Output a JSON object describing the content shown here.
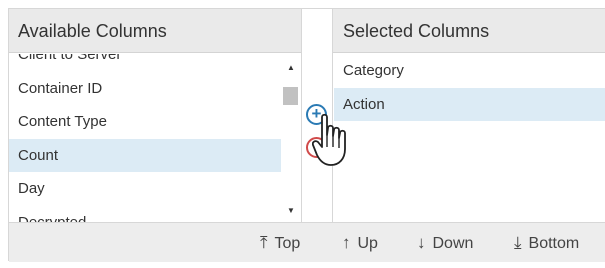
{
  "available": {
    "header": "Available Columns",
    "items": [
      {
        "label": "Client to Server"
      },
      {
        "label": "Container ID"
      },
      {
        "label": "Content Type"
      },
      {
        "label": "Count"
      },
      {
        "label": "Day"
      },
      {
        "label": "Decrypted"
      }
    ],
    "selected_item": "Count"
  },
  "selected": {
    "header": "Selected Columns",
    "items": [
      {
        "label": "Category"
      },
      {
        "label": "Action"
      }
    ],
    "selected_item": "Action"
  },
  "transfer": {
    "add_icon": "plus-circle-icon",
    "remove_icon": "minus-circle-icon"
  },
  "footer": {
    "top_label": "Top",
    "up_label": "Up",
    "down_label": "Down",
    "bottom_label": "Bottom"
  },
  "colors": {
    "header_bg": "#eaeaea",
    "selection_bg": "#dcebf5",
    "add_accent": "#2a7ab4",
    "remove_accent": "#d04a4a"
  }
}
